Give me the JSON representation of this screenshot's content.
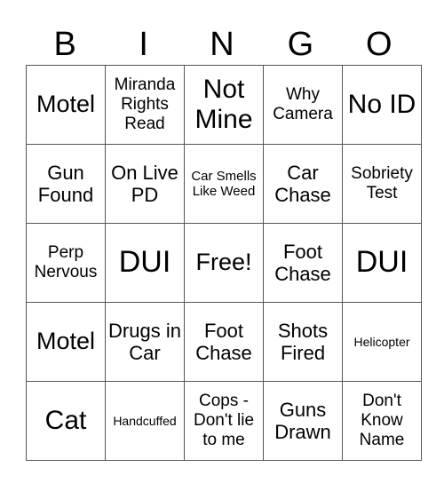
{
  "title_letters": [
    "B",
    "I",
    "N",
    "G",
    "O"
  ],
  "board": [
    [
      "Motel",
      "Miranda Rights Read",
      "Not Mine",
      "Why Camera",
      "No ID"
    ],
    [
      "Gun Found",
      "On Live PD",
      "Car Smells Like Weed",
      "Car Chase",
      "Sobriety Test"
    ],
    [
      "Perp Nervous",
      "DUI",
      "Free!",
      "Foot Chase",
      "DUI"
    ],
    [
      "Motel",
      "Drugs in Car",
      "Foot Chase",
      "Shots Fired",
      "Helicopter"
    ],
    [
      "Cat",
      "Handcuffed",
      "Cops - Don't lie to me",
      "Guns Drawn",
      "Don't Know Name"
    ]
  ]
}
